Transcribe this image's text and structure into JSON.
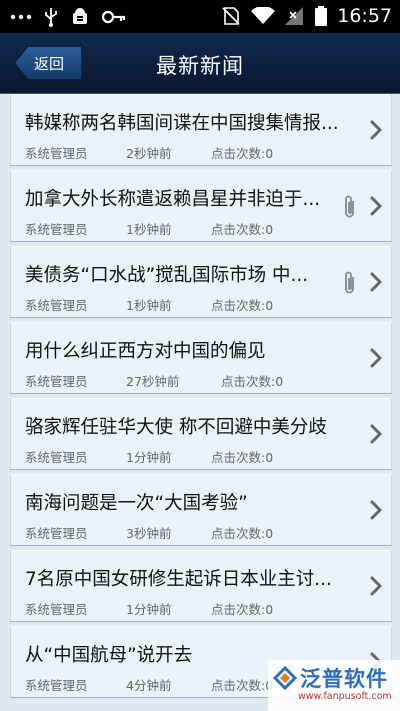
{
  "statusbar": {
    "time": "16:57",
    "icons": [
      "more-dots-icon",
      "usb-icon",
      "android-debug-icon",
      "key-icon",
      "no-sim-icon",
      "wifi-icon",
      "signal-icon",
      "battery-icon"
    ]
  },
  "header": {
    "back_label": "返回",
    "title": "最新新闻"
  },
  "news": [
    {
      "title": "韩媒称两名韩国间谍在中国搜集情报...",
      "author": "系统管理员",
      "time": "2秒钟前",
      "clicks": "点击次数:0",
      "attachment": false
    },
    {
      "title": "加拿大外长称遣返赖昌星并非迫于...",
      "author": "系统管理员",
      "time": "1秒钟前",
      "clicks": "点击次数:0",
      "attachment": true
    },
    {
      "title": "美债务“口水战”搅乱国际市场 中...",
      "author": "系统管理员",
      "time": "1秒钟前",
      "clicks": "点击次数:0",
      "attachment": true
    },
    {
      "title": "用什么纠正西方对中国的偏见",
      "author": "系统管理员",
      "time": "27秒钟前",
      "clicks": "点击次数:0",
      "attachment": false
    },
    {
      "title": "骆家辉任驻华大使 称不回避中美分歧",
      "author": "系统管理员",
      "time": "1分钟前",
      "clicks": "点击次数:0",
      "attachment": false
    },
    {
      "title": "南海问题是一次“大国考验”",
      "author": "系统管理员",
      "time": "3秒钟前",
      "clicks": "点击次数:0",
      "attachment": false
    },
    {
      "title": "7名原中国女研修生起诉日本业主讨...",
      "author": "系统管理员",
      "time": "1分钟前",
      "clicks": "点击次数:0",
      "attachment": false
    },
    {
      "title": "从“中国航母”说开去",
      "author": "系统管理员",
      "time": "4分钟前",
      "clicks": "点击次数:0",
      "attachment": false
    }
  ],
  "watermark": {
    "brand": "泛普软件",
    "url": "www.fanpusoft.com"
  },
  "colors": {
    "titlebar": "#0b1f3d",
    "list_bg": "#eaf2f9",
    "brand_blue": "#2a6fb8"
  }
}
